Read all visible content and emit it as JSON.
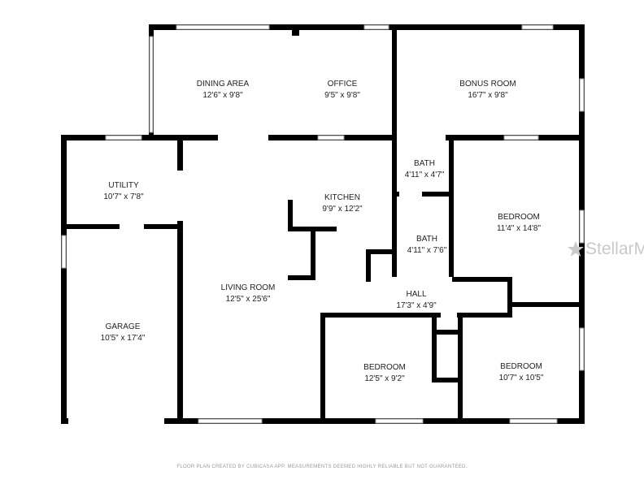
{
  "rooms": [
    {
      "name": "DINING AREA",
      "size": "12'6\" x 9'8\""
    },
    {
      "name": "OFFICE",
      "size": "9'5\" x 9'8\""
    },
    {
      "name": "BONUS ROOM",
      "size": "16'7\" x 9'8\""
    },
    {
      "name": "UTILITY",
      "size": "10'7\" x 7'8\""
    },
    {
      "name": "BATH",
      "size": "4'11\" x 4'7\""
    },
    {
      "name": "KITCHEN",
      "size": "9'9\" x 12'2\""
    },
    {
      "name": "BEDROOM",
      "size": "11'4\" x 14'8\""
    },
    {
      "name": "BATH",
      "size": "4'11\" x 7'6\""
    },
    {
      "name": "LIVING ROOM",
      "size": "12'5\" x 25'6\""
    },
    {
      "name": "HALL",
      "size": "17'3\" x 4'9\""
    },
    {
      "name": "GARAGE",
      "size": "10'5\" x 17'4\""
    },
    {
      "name": "BEDROOM",
      "size": "12'5\" x 9'2\""
    },
    {
      "name": "BEDROOM",
      "size": "10'7\" x 10'5\""
    }
  ],
  "footer": "FLOOR PLAN CREATED BY CUBICASA APP. MEASUREMENTS DEEMED HIGHLY RELIABLE BUT NOT GUARANTEED.",
  "watermark": "StellarMLS",
  "colors": {
    "wall": "#000000",
    "window": "#9a9a9a",
    "text": "#222222",
    "watermark": "#c9c9c9"
  }
}
